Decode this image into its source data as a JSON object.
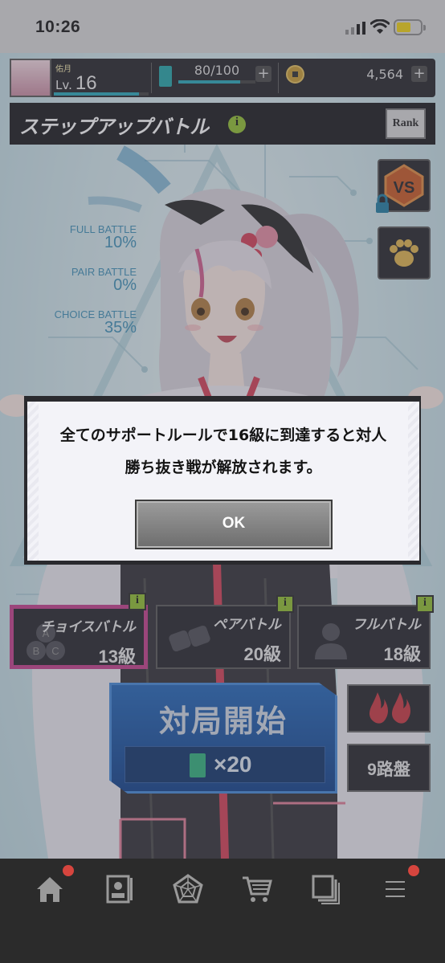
{
  "status_bar": {
    "time": "10:26"
  },
  "player": {
    "name": "佑月",
    "level_prefix": "Lv.",
    "level": "16",
    "energy": "80/100",
    "coins": "4,564",
    "energy_fraction": 0.8,
    "level_progress_fraction": 0.9
  },
  "title_bar": {
    "title": "ステップアップバトル",
    "info_icon": "info-icon",
    "rank_label": "Rank"
  },
  "stats": [
    {
      "label": "FULL BATTLE",
      "value": "10%"
    },
    {
      "label": "PAIR BATTLE",
      "value": "0%"
    },
    {
      "label": "CHOICE BATTLE",
      "value": "35%"
    }
  ],
  "side_buttons": [
    {
      "icon": "vs-icon",
      "locked": true
    },
    {
      "icon": "paw-icon",
      "locked": false
    }
  ],
  "modes": [
    {
      "name": "チョイスバトル",
      "level": "13級",
      "selected": true,
      "icon": "abc-icon"
    },
    {
      "name": "ペアバトル",
      "level": "20級",
      "selected": false,
      "icon": "fist-bump-icon"
    },
    {
      "name": "フルバトル",
      "level": "18級",
      "selected": false,
      "icon": "person-icon"
    }
  ],
  "start_button": {
    "label": "対局開始",
    "cost": "×20"
  },
  "right_buttons": {
    "fire_icon": "fire-icon",
    "board_size": "9路盤"
  },
  "dialog": {
    "message_line1": "全てのサポートルールで16級に到達すると対人",
    "message_line2": "勝ち抜き戦が解放されます。",
    "ok_label": "OK"
  },
  "bottom_nav": [
    {
      "icon": "home-icon",
      "badge": true
    },
    {
      "icon": "card-icon",
      "badge": false
    },
    {
      "icon": "radar-chart-icon",
      "badge": false
    },
    {
      "icon": "shop-cart-icon",
      "badge": false
    },
    {
      "icon": "stack-icon",
      "badge": false
    },
    {
      "icon": "menu-icon",
      "badge": true
    }
  ],
  "colors": {
    "accent_blue": "#1d63b8",
    "selected_magenta": "#c33a8a",
    "info_green": "#8fbf2a",
    "badge_red": "#d6453e",
    "energy_teal": "#23a6b8"
  }
}
